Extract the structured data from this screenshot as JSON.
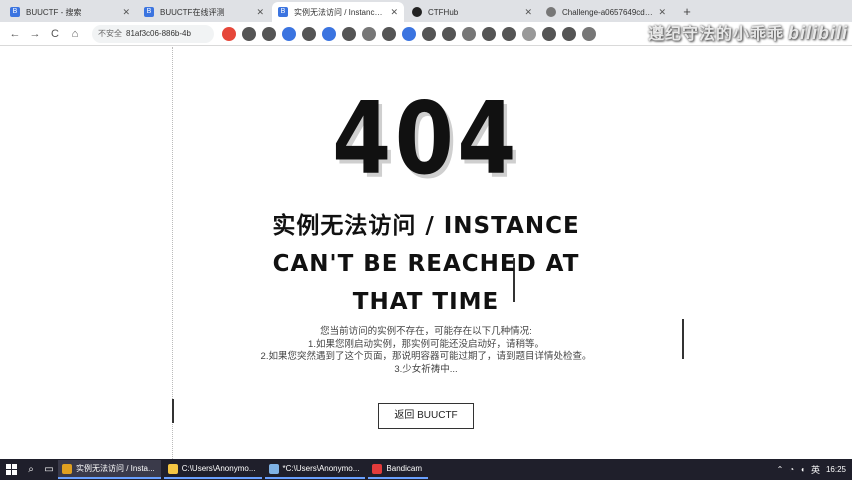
{
  "browser": {
    "tabs": [
      {
        "label": "BUUCTF - 搜索",
        "icon": "buuctf-favicon",
        "active": false
      },
      {
        "label": "BUUCTF在线评测",
        "icon": "buuctf-favicon",
        "active": false
      },
      {
        "label": "实例无法访问 / Instance can't",
        "icon": "buuctf-favicon",
        "active": true
      },
      {
        "label": "CTFHub",
        "icon": "github-favicon",
        "active": false
      },
      {
        "label": "Challenge-a0657649cd6b04",
        "icon": "globe-favicon",
        "active": false
      }
    ],
    "new_tab": "+",
    "toolbar": {
      "back": "←",
      "forward": "→",
      "reload": "C",
      "home": "⌂",
      "security_label": "不安全",
      "url": "81af3c06-886b-4b"
    }
  },
  "watermark": {
    "text": "遵纪守法的小乖乖",
    "logo": "bilibili"
  },
  "page": {
    "code": "404",
    "headline": "实例无法访问 / INSTANCE CAN'T BE REACHED AT THAT TIME",
    "desc_lines": [
      "您当前访问的实例不存在，可能存在以下几种情况:",
      "1.如果您刚启动实例，那实例可能还没启动好，请稍等。",
      "2.如果您突然遇到了这个页面，那说明容器可能过期了，请到题目详情处检查。",
      "3.少女祈祷中..."
    ],
    "back_button": "返回 BUUCTF"
  },
  "taskbar": {
    "items": [
      {
        "label": "实例无法访问 / Insta...",
        "icon": "chrome-icon",
        "active": true
      },
      {
        "label": "C:\\Users\\Anonymo...",
        "icon": "folder-icon",
        "active": false
      },
      {
        "label": "*C:\\Users\\Anonymo...",
        "icon": "notepad-icon",
        "active": false
      },
      {
        "label": "Bandicam",
        "icon": "bandicam-icon",
        "active": false
      }
    ],
    "tray": {
      "ime": "英",
      "time": "16:25"
    }
  }
}
